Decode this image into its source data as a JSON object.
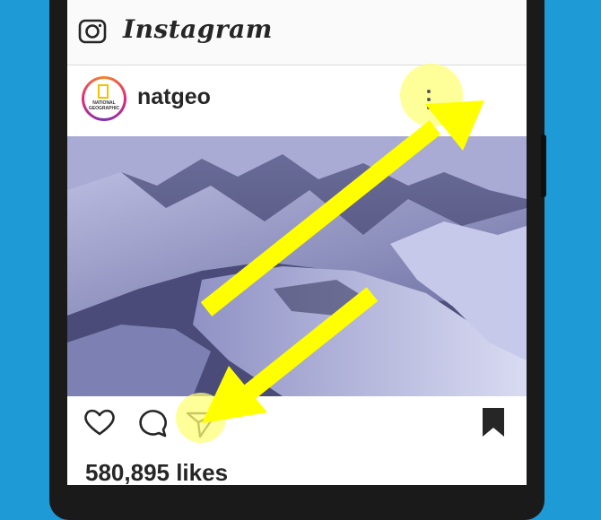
{
  "header": {
    "logo_text": "Instagram",
    "camera_icon": "camera-icon"
  },
  "post": {
    "username": "natgeo",
    "avatar_text": "NATIONAL GEOGRAPHIC",
    "avatar_accent": "#f6c200",
    "more_icon": "more-vertical-icon",
    "image_subject": "snow-covered-mountain-ridge",
    "likes": "580,895 likes"
  },
  "actions": {
    "like_icon": "heart-icon",
    "comment_icon": "comment-icon",
    "share_icon": "paper-plane-icon",
    "save_icon": "bookmark-icon"
  },
  "annotations": {
    "highlight_color": "#ffff00",
    "arrows": [
      "arrow-to-more-options",
      "arrow-to-share"
    ]
  }
}
